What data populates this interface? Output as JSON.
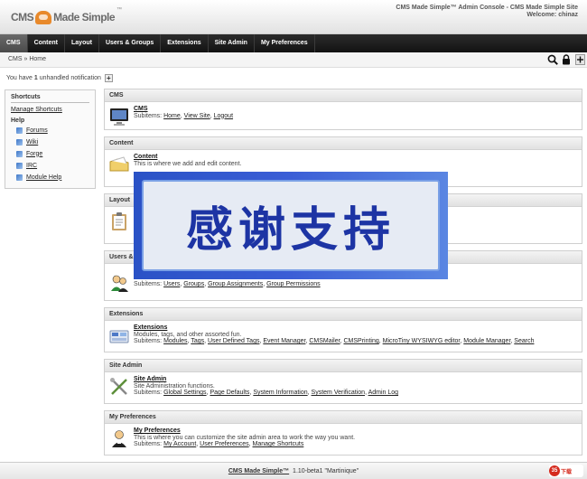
{
  "header": {
    "logo": {
      "cms": "CMS",
      "rest": "Made Simple",
      "tm": "™"
    },
    "console_title": "CMS Made Simple™ Admin Console - CMS Made Simple Site",
    "welcome": "Welcome: chinaz"
  },
  "nav": {
    "tabs": [
      {
        "label": "CMS",
        "active": true
      },
      {
        "label": "Content"
      },
      {
        "label": "Layout"
      },
      {
        "label": "Users & Groups"
      },
      {
        "label": "Extensions"
      },
      {
        "label": "Site Admin"
      },
      {
        "label": "My Preferences"
      }
    ]
  },
  "breadcrumb": "CMS » Home",
  "tools": {
    "icons": [
      "search-icon",
      "lock-icon",
      "add-icon"
    ]
  },
  "notification": {
    "pre": "You have",
    "count": "1",
    "post": "unhandled notification",
    "plus": "+"
  },
  "sidebar": {
    "shortcuts_heading": "Shortcuts",
    "manage_shortcuts": "Manage Shortcuts",
    "help_heading": "Help",
    "help_items": [
      "Forums",
      "Wiki",
      "Forge",
      "IRC",
      "Module Help"
    ]
  },
  "sections": {
    "cms": {
      "heading": "CMS",
      "title": "CMS",
      "desc": "",
      "subitems_label": "Subitems:",
      "subitems": [
        "Home",
        "View Site",
        "Logout"
      ]
    },
    "content": {
      "heading": "Content",
      "title": "Content",
      "desc": "This is where we add and edit content."
    },
    "layout": {
      "heading": "Layout"
    },
    "users": {
      "heading": "Users & G",
      "subitems_label": "Subitems:",
      "subitems": [
        "Users",
        "Groups",
        "Group Assignments",
        "Group Permissions"
      ]
    },
    "extensions": {
      "heading": "Extensions",
      "title": "Extensions",
      "desc": "Modules, tags, and other assorted fun.",
      "subitems_label": "Subitems:",
      "subitems": [
        "Modules",
        "Tags",
        "User Defined Tags",
        "Event Manager",
        "CMSMailer",
        "CMSPrinting",
        "MicroTiny WYSIWYG editor",
        "Module Manager",
        "Search"
      ]
    },
    "siteadmin": {
      "heading": "Site Admin",
      "title": "Site Admin",
      "desc": "Site Administration functions.",
      "subitems_label": "Subitems:",
      "subitems": [
        "Global Settings",
        "Page Defaults",
        "System Information",
        "System Verification",
        "Admin Log"
      ]
    },
    "prefs": {
      "heading": "My Preferences",
      "title": "My Preferences",
      "desc": "This is where you can customize the site admin area to work the way you want.",
      "subitems_label": "Subitems:",
      "subitems": [
        "My Account",
        "User Preferences",
        "Manage Shortcuts"
      ]
    }
  },
  "footer": {
    "product": "CMS Made Simple™",
    "version": "1.10-beta1 \"Martinique\"",
    "badge_num": "35",
    "badge_text": "下载"
  },
  "overlay": {
    "text": "感谢支持"
  },
  "colors": {
    "nav_bg": "#1a1a1a",
    "overlay_blue": "#3b5ed6",
    "overlay_text": "#1d34a4"
  }
}
